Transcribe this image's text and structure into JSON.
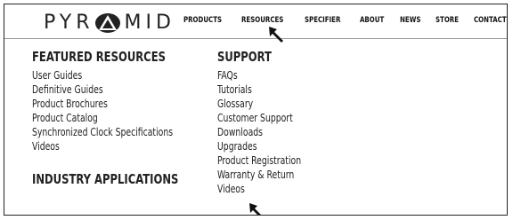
{
  "logo": {
    "prefix": "PYR",
    "suffix": "MID"
  },
  "nav": {
    "items": [
      "PRODUCTS",
      "RESOURCES",
      "SPECIFIER",
      "ABOUT",
      "NEWS",
      "STORE",
      "CONTACT"
    ]
  },
  "featured": {
    "title": "FEATURED RESOURCES",
    "items": [
      "User Guides",
      "Definitive Guides",
      "Product Brochures",
      "Product Catalog",
      "Synchronized Clock Specifications",
      "Videos"
    ]
  },
  "industry": {
    "title": "INDUSTRY APPLICATIONS"
  },
  "support": {
    "title": "SUPPORT",
    "items": [
      "FAQs",
      "Tutorials",
      "Glossary",
      "Customer Support",
      "Downloads",
      "Upgrades",
      "Product Registration",
      "Warranty & Return",
      "Videos"
    ]
  },
  "icons": {
    "logo_mark": "triangle-logo-icon",
    "pointer": "arrow-cursor-icon"
  }
}
